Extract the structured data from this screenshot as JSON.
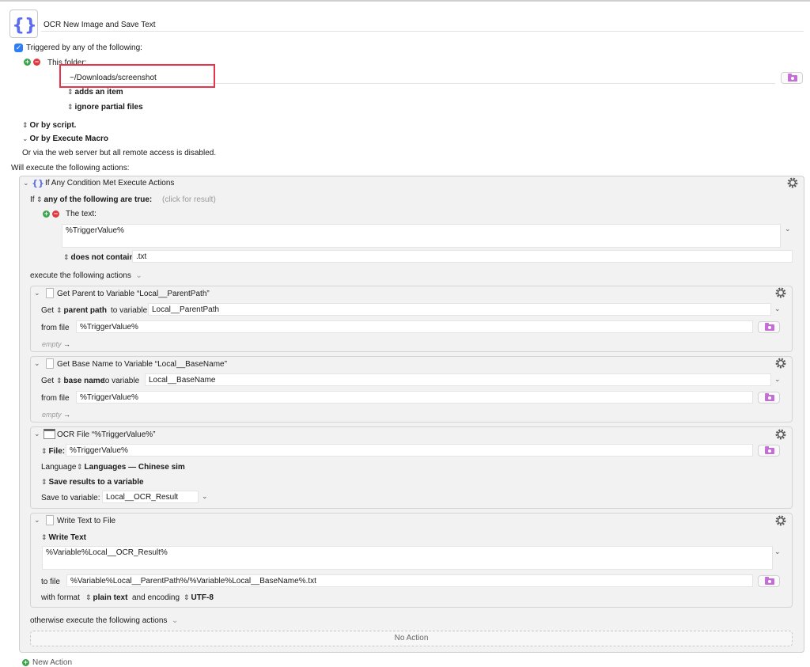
{
  "macro": {
    "title": "OCR New Image and Save Text"
  },
  "trigger": {
    "header": "Triggered by any of the following:",
    "folder_label": "This folder:",
    "folder_path": "~/Downloads/screenshot",
    "adds_item": "adds an item",
    "ignore_partial": "ignore partial files",
    "or_by_script": "Or by script.",
    "or_by_execute": "Or by Execute Macro",
    "web_server": "Or via the web server but all remote access is disabled."
  },
  "actions_header": "Will execute the following actions:",
  "if_action": {
    "title": "If Any Condition Met Execute Actions",
    "if_label": "If",
    "any_label": "any of the following are true:",
    "click_result": "(click for result)",
    "text_label": "The text:",
    "text_value": "%TriggerValue%",
    "does_not_contain": "does not contain",
    "contain_value": ".txt",
    "execute_label": "execute the following actions",
    "otherwise_label": "otherwise execute the following actions",
    "no_action": "No Action"
  },
  "parent_action": {
    "title": "Get Parent to Variable “Local__ParentPath”",
    "get_label": "Get",
    "mode": "parent path",
    "to_variable_label": "to variable",
    "variable": "Local__ParentPath",
    "from_file_label": "from file",
    "file": "%TriggerValue%",
    "empty": "empty"
  },
  "basename_action": {
    "title": "Get Base Name to Variable “Local__BaseName”",
    "get_label": "Get",
    "mode": "base name",
    "to_variable_label": "to variable",
    "variable": "Local__BaseName",
    "from_file_label": "from file",
    "file": "%TriggerValue%",
    "empty": "empty"
  },
  "ocr_action": {
    "title": "OCR File “%TriggerValue%”",
    "file_label": "File:",
    "file": "%TriggerValue%",
    "language_label": "Language",
    "language_value": "Languages — Chinese sim",
    "save_results": "Save results to a variable",
    "save_to_label": "Save to variable:",
    "save_to_value": "Local__OCR_Result"
  },
  "write_action": {
    "title": "Write Text to File",
    "write_label": "Write Text",
    "text": "%Variable%Local__OCR_Result%",
    "to_file_label": "to file",
    "to_file": "%Variable%Local__ParentPath%/%Variable%Local__BaseName%.txt",
    "with_format_label": "with format",
    "format_value": "plain text",
    "encoding_label": "and encoding",
    "encoding_value": "UTF-8"
  },
  "new_action": "New Action",
  "colors": {
    "accent": "#2d7df6",
    "highlight": "#e8334a",
    "folder": "#c56cd6"
  }
}
